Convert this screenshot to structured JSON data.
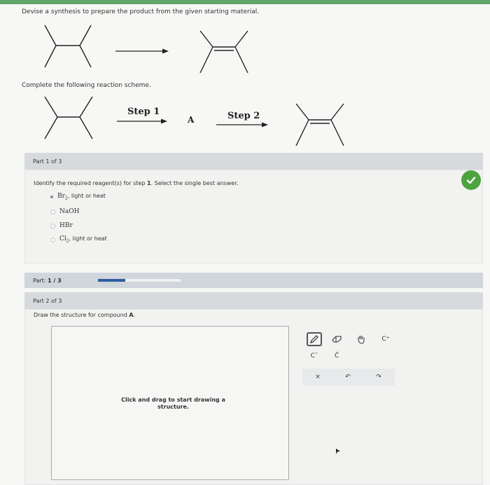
{
  "question": {
    "title": "Devise a synthesis to prepare the product from the given starting material.",
    "scheme_label": "Complete the following reaction scheme."
  },
  "scheme": {
    "step1": "Step 1",
    "step2": "Step 2",
    "compound": "A"
  },
  "part1": {
    "header": "Part 1 of 3",
    "prompt_prefix": "Identify the required reagent(s) for step ",
    "prompt_step": "1",
    "prompt_suffix": ". Select the single best answer.",
    "options": [
      {
        "main": "Br",
        "sub": "2",
        "rest": ", light or heat",
        "selected": true
      },
      {
        "main": "NaOH",
        "sub": "",
        "rest": "",
        "selected": false
      },
      {
        "main": "HBr",
        "sub": "",
        "rest": "",
        "selected": false
      },
      {
        "main": "Cl",
        "sub": "2",
        "rest": ", light or heat",
        "selected": false
      }
    ],
    "status": "correct"
  },
  "progress": {
    "label": "Part:",
    "value": "1 / 3",
    "fraction": 0.333
  },
  "part2": {
    "header": "Part 2 of 3",
    "prompt_prefix": "Draw the structure for compound ",
    "prompt_bold": "A",
    "prompt_suffix": ".",
    "canvas_hint": "Click and drag to start drawing a structure."
  },
  "toolbar": {
    "tools": [
      {
        "icon": "pencil-icon"
      },
      {
        "icon": "eraser-icon"
      },
      {
        "icon": "hand-icon"
      },
      {
        "icon": "cation-icon",
        "label": "C⁺"
      },
      {
        "icon": "anion-icon",
        "label": "C¯"
      },
      {
        "icon": "lone-pair-icon",
        "label": "C̈"
      },
      {
        "icon": "clear-icon",
        "label": "×"
      },
      {
        "icon": "undo-icon",
        "label": "↶"
      },
      {
        "icon": "redo-icon",
        "label": "↷"
      }
    ]
  },
  "colors": {
    "accent_green": "#4ca340",
    "progress_blue": "#2f5ea0"
  }
}
